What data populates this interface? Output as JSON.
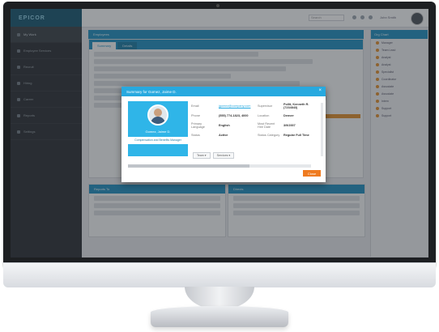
{
  "app": {
    "logo": "EPICOR"
  },
  "sidebar": {
    "items": [
      {
        "label": "My Work"
      },
      {
        "label": "Employee Services"
      },
      {
        "label": "Recruit"
      },
      {
        "label": "Hiring"
      },
      {
        "label": "Career"
      },
      {
        "label": "Reports"
      },
      {
        "label": "Settings"
      }
    ]
  },
  "topbar": {
    "search_placeholder": "Search",
    "user": "John Smith"
  },
  "main": {
    "panel_title": "Employees",
    "tabs": [
      "Summary",
      "Details"
    ],
    "bottom_left_title": "Reports To",
    "bottom_right_title": "Directs"
  },
  "right_panel": {
    "title": "Org Chart",
    "items": [
      "Manager",
      "Team Lead",
      "Analyst",
      "Analyst",
      "Specialist",
      "Coordinator",
      "Associate",
      "Associate",
      "Intern",
      "Support",
      "Support"
    ]
  },
  "dialog": {
    "title": "Summary for Gomez, Jaime D.",
    "close_glyph": "×",
    "profile": {
      "name": "Gomez, Jaime D.",
      "role": "Compensation and Benefits Manager"
    },
    "fields": [
      {
        "label": "Email",
        "value": "jgomez@company.com"
      },
      {
        "label": "Supervisor",
        "value": "Pollit, Kenneth R. (7234843)"
      },
      {
        "label": "Phone",
        "value": "(555) 774-1823, 4000"
      },
      {
        "label": "Location",
        "value": "Denver"
      },
      {
        "label": "Primary Language",
        "value": "English"
      },
      {
        "label": "Most Recent Hire Date",
        "value": "3/9/2007"
      },
      {
        "label": "Status",
        "value": "Active"
      },
      {
        "label": "Status Category",
        "value": "Regular Full Time"
      }
    ],
    "actions": [
      "Team ▾",
      "Services ▾"
    ],
    "close_label": "Close"
  },
  "colors": {
    "accent": "#27a9df",
    "header": "#1f8fbf",
    "orange": "#ef7b20",
    "sidebar": "#2b2f33"
  }
}
